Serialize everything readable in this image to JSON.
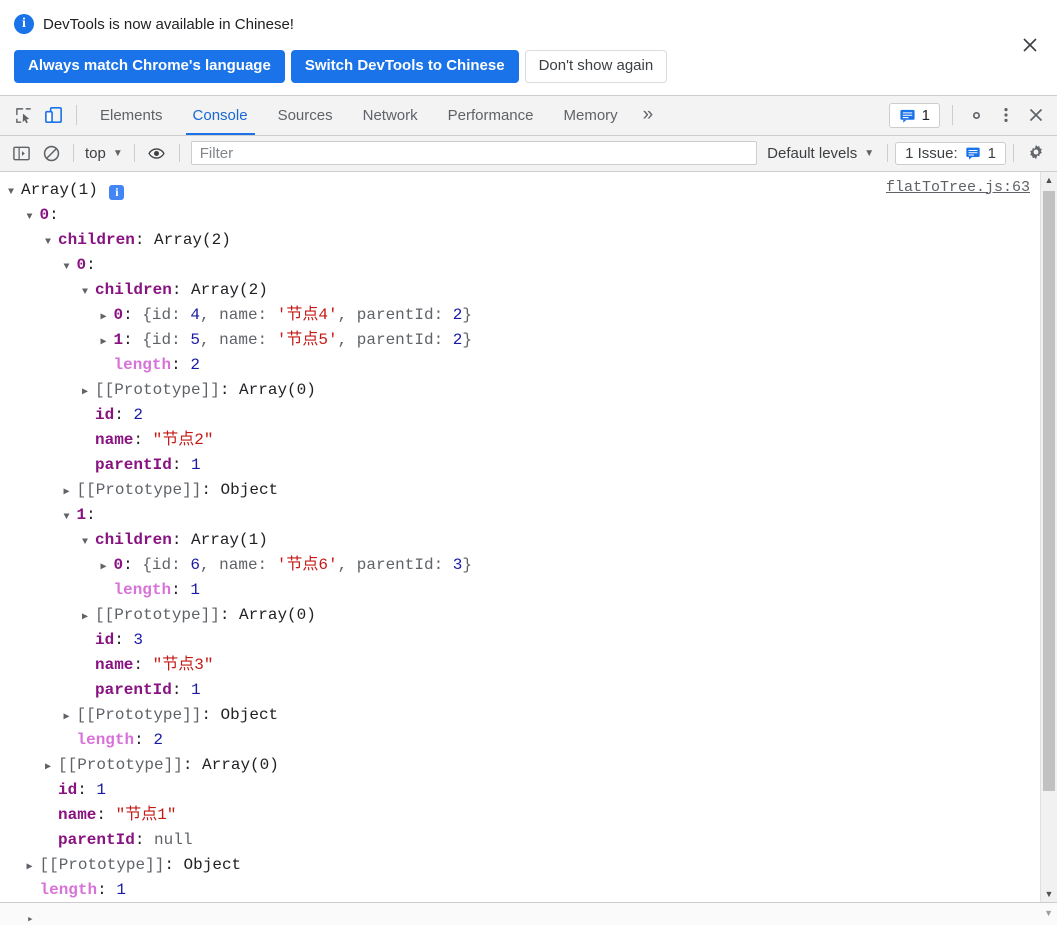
{
  "banner": {
    "info_icon": "info-icon",
    "message": "DevTools is now available in Chinese!",
    "primary_button_1": "Always match Chrome's language",
    "primary_button_2": "Switch DevTools to Chinese",
    "secondary_button": "Don't show again",
    "close_icon": "close-icon",
    "accent_color": "#1a73e8"
  },
  "devtools_tabs": {
    "inspect_icon": "inspect-element-icon",
    "device_icon": "device-toolbar-icon",
    "device_icon_active_color": "#1a73e8",
    "items": [
      {
        "label": "Elements",
        "active": false
      },
      {
        "label": "Console",
        "active": true
      },
      {
        "label": "Sources",
        "active": false
      },
      {
        "label": "Network",
        "active": false
      },
      {
        "label": "Performance",
        "active": false
      },
      {
        "label": "Memory",
        "active": false
      }
    ],
    "more_tabs_icon": "chevron-double-right-icon",
    "issue_chip_icon": "issue-message-icon",
    "issue_chip_count": "1",
    "settings_icon": "gear-icon",
    "menu_icon": "kebab-menu-icon",
    "close_icon": "close-icon"
  },
  "console_toolbar": {
    "sidebar_icon": "console-sidebar-icon",
    "clear_icon": "clear-console-icon",
    "context": "top",
    "context_caret": "chevron-down-icon",
    "eye_icon": "live-expressions-eye-icon",
    "filter_placeholder": "Filter",
    "filter_value": "",
    "levels_label": "Default levels",
    "levels_caret": "chevron-down-icon",
    "issues_label": "1 Issue:",
    "issues_icon": "issue-message-icon",
    "issues_count": "1",
    "settings_icon": "gear-icon"
  },
  "console_output": {
    "source_link": "flatToTree.js:63",
    "info_badge": "i",
    "lines": [
      {
        "indent": 0,
        "arrow": "open",
        "segments": [
          {
            "t": "Array(1) ",
            "c": "v-plain"
          }
        ],
        "badge": true
      },
      {
        "indent": 1,
        "arrow": "open",
        "segments": [
          {
            "t": "0",
            "c": "k-idx"
          },
          {
            "t": ":",
            "c": "v-plain"
          }
        ]
      },
      {
        "indent": 2,
        "arrow": "open",
        "segments": [
          {
            "t": "children",
            "c": "k-prop"
          },
          {
            "t": ": ",
            "c": "v-plain"
          },
          {
            "t": "Array(2)",
            "c": "v-plain"
          }
        ]
      },
      {
        "indent": 3,
        "arrow": "open",
        "segments": [
          {
            "t": "0",
            "c": "k-idx"
          },
          {
            "t": ":",
            "c": "v-plain"
          }
        ]
      },
      {
        "indent": 4,
        "arrow": "open",
        "segments": [
          {
            "t": "children",
            "c": "k-prop"
          },
          {
            "t": ": ",
            "c": "v-plain"
          },
          {
            "t": "Array(2)",
            "c": "v-plain"
          }
        ]
      },
      {
        "indent": 5,
        "arrow": "closed",
        "segments": [
          {
            "t": "0",
            "c": "k-idx"
          },
          {
            "t": ": ",
            "c": "v-plain"
          },
          {
            "t": "{",
            "c": "v-dim"
          },
          {
            "t": "id",
            "c": "v-dim"
          },
          {
            "t": ": ",
            "c": "v-dim"
          },
          {
            "t": "4",
            "c": "v-num"
          },
          {
            "t": ", ",
            "c": "v-dim"
          },
          {
            "t": "name",
            "c": "v-dim"
          },
          {
            "t": ": ",
            "c": "v-dim"
          },
          {
            "t": "'节点4'",
            "c": "v-str"
          },
          {
            "t": ", ",
            "c": "v-dim"
          },
          {
            "t": "parentId",
            "c": "v-dim"
          },
          {
            "t": ": ",
            "c": "v-dim"
          },
          {
            "t": "2",
            "c": "v-num"
          },
          {
            "t": "}",
            "c": "v-dim"
          }
        ]
      },
      {
        "indent": 5,
        "arrow": "closed",
        "segments": [
          {
            "t": "1",
            "c": "k-idx"
          },
          {
            "t": ": ",
            "c": "v-plain"
          },
          {
            "t": "{",
            "c": "v-dim"
          },
          {
            "t": "id",
            "c": "v-dim"
          },
          {
            "t": ": ",
            "c": "v-dim"
          },
          {
            "t": "5",
            "c": "v-num"
          },
          {
            "t": ", ",
            "c": "v-dim"
          },
          {
            "t": "name",
            "c": "v-dim"
          },
          {
            "t": ": ",
            "c": "v-dim"
          },
          {
            "t": "'节点5'",
            "c": "v-str"
          },
          {
            "t": ", ",
            "c": "v-dim"
          },
          {
            "t": "parentId",
            "c": "v-dim"
          },
          {
            "t": ": ",
            "c": "v-dim"
          },
          {
            "t": "2",
            "c": "v-num"
          },
          {
            "t": "}",
            "c": "v-dim"
          }
        ]
      },
      {
        "indent": 5,
        "arrow": "none",
        "segments": [
          {
            "t": "length",
            "c": "k-len"
          },
          {
            "t": ": ",
            "c": "v-plain"
          },
          {
            "t": "2",
            "c": "v-num"
          }
        ]
      },
      {
        "indent": 4,
        "arrow": "closed",
        "segments": [
          {
            "t": "[[Prototype]]",
            "c": "k-proto"
          },
          {
            "t": ": ",
            "c": "v-plain"
          },
          {
            "t": "Array(0)",
            "c": "v-plain"
          }
        ]
      },
      {
        "indent": 4,
        "arrow": "none",
        "segments": [
          {
            "t": "id",
            "c": "k-prop"
          },
          {
            "t": ": ",
            "c": "v-plain"
          },
          {
            "t": "2",
            "c": "v-num"
          }
        ]
      },
      {
        "indent": 4,
        "arrow": "none",
        "segments": [
          {
            "t": "name",
            "c": "k-prop"
          },
          {
            "t": ": ",
            "c": "v-plain"
          },
          {
            "t": "\"节点2\"",
            "c": "v-str"
          }
        ]
      },
      {
        "indent": 4,
        "arrow": "none",
        "segments": [
          {
            "t": "parentId",
            "c": "k-prop"
          },
          {
            "t": ": ",
            "c": "v-plain"
          },
          {
            "t": "1",
            "c": "v-num"
          }
        ]
      },
      {
        "indent": 3,
        "arrow": "closed",
        "segments": [
          {
            "t": "[[Prototype]]",
            "c": "k-proto"
          },
          {
            "t": ": ",
            "c": "v-plain"
          },
          {
            "t": "Object",
            "c": "v-plain"
          }
        ]
      },
      {
        "indent": 3,
        "arrow": "open",
        "segments": [
          {
            "t": "1",
            "c": "k-idx"
          },
          {
            "t": ":",
            "c": "v-plain"
          }
        ]
      },
      {
        "indent": 4,
        "arrow": "open",
        "segments": [
          {
            "t": "children",
            "c": "k-prop"
          },
          {
            "t": ": ",
            "c": "v-plain"
          },
          {
            "t": "Array(1)",
            "c": "v-plain"
          }
        ]
      },
      {
        "indent": 5,
        "arrow": "closed",
        "segments": [
          {
            "t": "0",
            "c": "k-idx"
          },
          {
            "t": ": ",
            "c": "v-plain"
          },
          {
            "t": "{",
            "c": "v-dim"
          },
          {
            "t": "id",
            "c": "v-dim"
          },
          {
            "t": ": ",
            "c": "v-dim"
          },
          {
            "t": "6",
            "c": "v-num"
          },
          {
            "t": ", ",
            "c": "v-dim"
          },
          {
            "t": "name",
            "c": "v-dim"
          },
          {
            "t": ": ",
            "c": "v-dim"
          },
          {
            "t": "'节点6'",
            "c": "v-str"
          },
          {
            "t": ", ",
            "c": "v-dim"
          },
          {
            "t": "parentId",
            "c": "v-dim"
          },
          {
            "t": ": ",
            "c": "v-dim"
          },
          {
            "t": "3",
            "c": "v-num"
          },
          {
            "t": "}",
            "c": "v-dim"
          }
        ]
      },
      {
        "indent": 5,
        "arrow": "none",
        "segments": [
          {
            "t": "length",
            "c": "k-len"
          },
          {
            "t": ": ",
            "c": "v-plain"
          },
          {
            "t": "1",
            "c": "v-num"
          }
        ]
      },
      {
        "indent": 4,
        "arrow": "closed",
        "segments": [
          {
            "t": "[[Prototype]]",
            "c": "k-proto"
          },
          {
            "t": ": ",
            "c": "v-plain"
          },
          {
            "t": "Array(0)",
            "c": "v-plain"
          }
        ]
      },
      {
        "indent": 4,
        "arrow": "none",
        "segments": [
          {
            "t": "id",
            "c": "k-prop"
          },
          {
            "t": ": ",
            "c": "v-plain"
          },
          {
            "t": "3",
            "c": "v-num"
          }
        ]
      },
      {
        "indent": 4,
        "arrow": "none",
        "segments": [
          {
            "t": "name",
            "c": "k-prop"
          },
          {
            "t": ": ",
            "c": "v-plain"
          },
          {
            "t": "\"节点3\"",
            "c": "v-str"
          }
        ]
      },
      {
        "indent": 4,
        "arrow": "none",
        "segments": [
          {
            "t": "parentId",
            "c": "k-prop"
          },
          {
            "t": ": ",
            "c": "v-plain"
          },
          {
            "t": "1",
            "c": "v-num"
          }
        ]
      },
      {
        "indent": 3,
        "arrow": "closed",
        "segments": [
          {
            "t": "[[Prototype]]",
            "c": "k-proto"
          },
          {
            "t": ": ",
            "c": "v-plain"
          },
          {
            "t": "Object",
            "c": "v-plain"
          }
        ]
      },
      {
        "indent": 3,
        "arrow": "none",
        "segments": [
          {
            "t": "length",
            "c": "k-len"
          },
          {
            "t": ": ",
            "c": "v-plain"
          },
          {
            "t": "2",
            "c": "v-num"
          }
        ]
      },
      {
        "indent": 2,
        "arrow": "closed",
        "segments": [
          {
            "t": "[[Prototype]]",
            "c": "k-proto"
          },
          {
            "t": ": ",
            "c": "v-plain"
          },
          {
            "t": "Array(0)",
            "c": "v-plain"
          }
        ]
      },
      {
        "indent": 2,
        "arrow": "none",
        "segments": [
          {
            "t": "id",
            "c": "k-prop"
          },
          {
            "t": ": ",
            "c": "v-plain"
          },
          {
            "t": "1",
            "c": "v-num"
          }
        ]
      },
      {
        "indent": 2,
        "arrow": "none",
        "segments": [
          {
            "t": "name",
            "c": "k-prop"
          },
          {
            "t": ": ",
            "c": "v-plain"
          },
          {
            "t": "\"节点1\"",
            "c": "v-str"
          }
        ]
      },
      {
        "indent": 2,
        "arrow": "none",
        "segments": [
          {
            "t": "parentId",
            "c": "k-prop"
          },
          {
            "t": ": ",
            "c": "v-plain"
          },
          {
            "t": "null",
            "c": "v-null"
          }
        ]
      },
      {
        "indent": 1,
        "arrow": "closed",
        "segments": [
          {
            "t": "[[Prototype]]",
            "c": "k-proto"
          },
          {
            "t": ": ",
            "c": "v-plain"
          },
          {
            "t": "Object",
            "c": "v-plain"
          }
        ]
      },
      {
        "indent": 1,
        "arrow": "none",
        "segments": [
          {
            "t": "length",
            "c": "k-len"
          },
          {
            "t": ": ",
            "c": "v-plain"
          },
          {
            "t": "1",
            "c": "v-num"
          }
        ]
      }
    ]
  },
  "scrollbar": {
    "up_arrow_icon": "scroll-up-arrow-icon",
    "down_arrow_icon": "scroll-down-arrow-icon",
    "thumb": "scrollbar-thumb"
  },
  "prompt": {
    "caret_icon": "console-prompt-caret-icon",
    "value": ""
  }
}
